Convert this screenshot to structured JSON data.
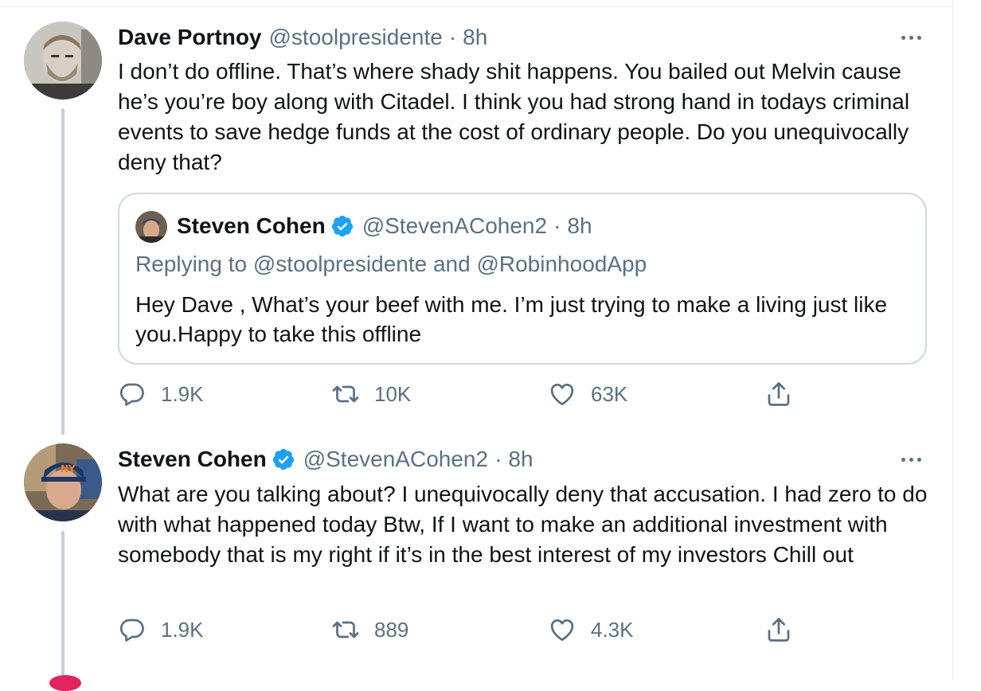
{
  "tweets": [
    {
      "name": "Dave Portnoy",
      "handle": "@stoolpresidente",
      "time": "8h",
      "text": "I don’t do offline. That’s where shady shit happens. You bailed out Melvin cause he’s you’re boy along with Citadel.  I think you had strong hand in todays criminal events to save hedge funds at the cost of ordinary people. Do you unequivocally deny that?",
      "quote": {
        "name": "Steven Cohen",
        "handle": "@StevenACohen2",
        "time": "8h",
        "replying_to": "Replying to @stoolpresidente and @RobinhoodApp",
        "text": "Hey Dave , What’s your beef with me. I’m just trying to make a living just like you.Happy to take this offline"
      },
      "replies": "1.9K",
      "retweets": "10K",
      "likes": "63K"
    },
    {
      "name": "Steven Cohen",
      "handle": "@StevenACohen2",
      "time": "8h",
      "text": "What are you talking about? I unequivocally deny that accusation. I had zero to do with what happened  today Btw, If I want to make an additional investment  with somebody that is my right if it’s in the best interest of my investors  Chill out",
      "replies": "1.9K",
      "retweets": "889",
      "likes": "4.3K"
    }
  ],
  "separator": "·",
  "colors": {
    "text": "#0f1419",
    "secondary": "#5b7083",
    "verified": "#1da1f2",
    "thread_line": "#c4cfd6",
    "border": "#cfd9de"
  },
  "icons": [
    "more-icon",
    "verified-badge-icon",
    "reply-icon",
    "retweet-icon",
    "like-icon",
    "share-icon"
  ]
}
